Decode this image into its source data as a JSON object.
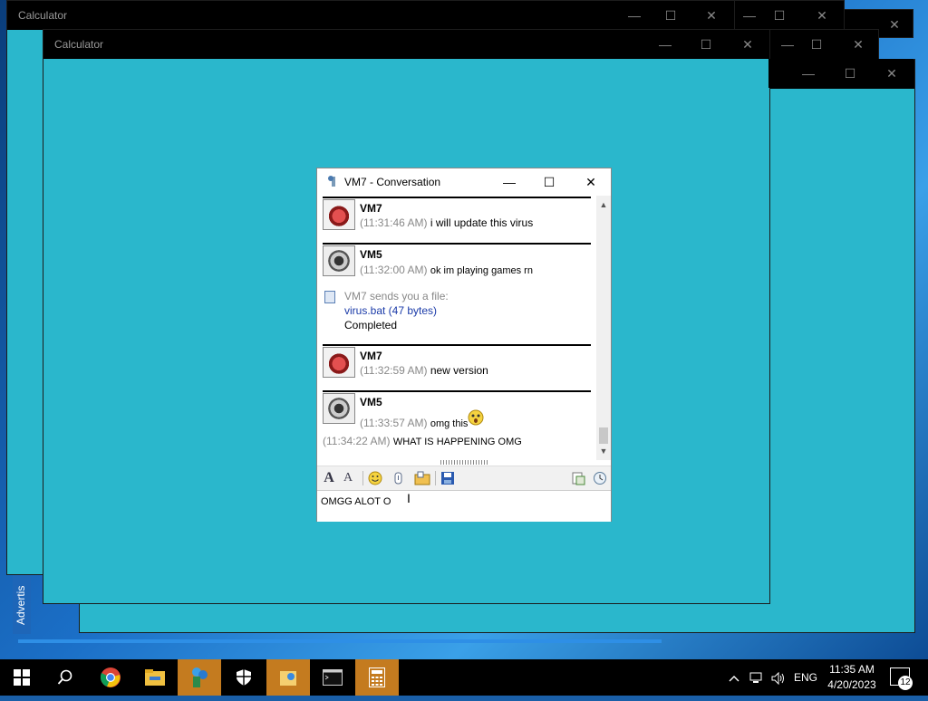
{
  "windows": {
    "calc_back_title": "Calculator",
    "calc_front_title": "Calculator",
    "background_color": "#2ab7cc"
  },
  "desktop": {
    "ad_text": "Advertis"
  },
  "chat": {
    "title": "VM7 - Conversation",
    "messages": [
      {
        "sender": "VM7",
        "time": "(11:31:46 AM)",
        "text": "i will update this virus"
      },
      {
        "sender": "VM5",
        "time": "(11:32:00 AM)",
        "text": "ok im playing games rn"
      },
      {
        "sender": "VM7",
        "time": "(11:32:59 AM)",
        "text": "new version"
      },
      {
        "sender": "VM5",
        "time": "(11:33:57 AM)",
        "text": "omg this"
      },
      {
        "time": "(11:34:22 AM)",
        "text": "WHAT IS HAPPENING OMG"
      }
    ],
    "file_transfer": {
      "intro": "VM7 sends you a file:",
      "file": "virus.bat (47 bytes)",
      "status": "Completed"
    },
    "input_value": "OMGG ALOT O"
  },
  "taskbar": {
    "language": "ENG",
    "time": "11:35 AM",
    "date": "4/20/2023",
    "notification_count": "12"
  }
}
